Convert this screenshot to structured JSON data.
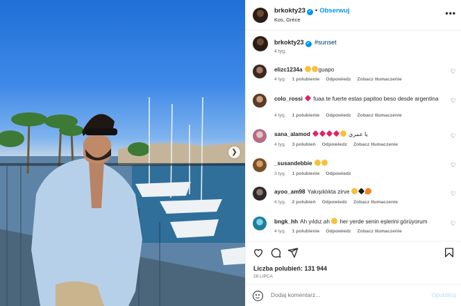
{
  "header": {
    "username": "brkokty23",
    "verified_glyph": "✓",
    "separator": "•",
    "follow_label": "Obserwuj",
    "location": "Kos, Grèce",
    "more_glyph": "•••"
  },
  "caption": {
    "username": "brkokty23",
    "verified_glyph": "✓",
    "text": "#sunset",
    "time": "4 tyg."
  },
  "comments": [
    {
      "user": "elizc1234a",
      "text": "guapo",
      "time": "4 tyg.",
      "likes": "1 polubienie",
      "reply": "Odpowiedz",
      "translate": "Zobacz tłumaczenie"
    },
    {
      "user": "colo_rossi",
      "text": "fuaa te fuerte estas papitoo beso desde argentina",
      "time": "4 tyg.",
      "likes": "1 polubienie",
      "reply": "Odpowiedz",
      "translate": "Zobacz tłumaczenie"
    },
    {
      "user": "sana_alamod",
      "text": "يا عمري",
      "time": "4 tyg.",
      "likes": "3 polubień",
      "reply": "Odpowiedz",
      "translate": "Zobacz tłumaczenie"
    },
    {
      "user": "_susandebbie",
      "text": "",
      "time": "3 tyg.",
      "likes": "1 polubienie",
      "reply": "Odpowiedz"
    },
    {
      "user": "ayoo_am98",
      "text": "Yakışıklıkta zirve",
      "time": "4 tyg.",
      "likes": "2 polubień",
      "reply": "Odpowiedz",
      "translate": "Zobacz tłumaczenie"
    },
    {
      "user": "bngk_hh",
      "text": "Ah yıldız ah",
      "text2": "her yerde senin eşlerini görüyorum",
      "time": "4 tyg.",
      "likes": "1 polubienie",
      "reply": "Odpowiedz",
      "translate": "Zobacz tłumaczenie"
    }
  ],
  "actions": {
    "likes_label": "Liczba polubień: 131 944",
    "date": "28 LIPCA"
  },
  "add_comment": {
    "placeholder": "Dodaj komentarz...",
    "post_label": "Opublikuj"
  },
  "colors": {
    "accent": "#0095f6",
    "muted": "#737373",
    "text": "#262626"
  },
  "icons": [
    "heart-icon",
    "comment-icon",
    "share-icon",
    "bookmark-icon",
    "emoji-icon",
    "chevron-right-icon",
    "more-icon",
    "verified-icon"
  ]
}
